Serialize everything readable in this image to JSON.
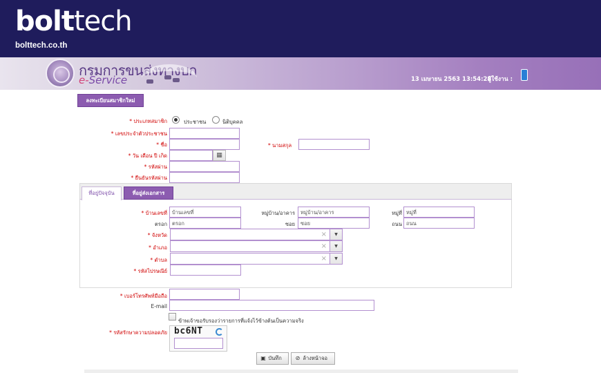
{
  "brand": {
    "logo_bold": "bolt",
    "logo_light": "tech",
    "url": "bolttech.co.th"
  },
  "banner": {
    "agency_title": "กรมการขนส่งทางบก",
    "eservice_e": "e-",
    "eservice_rest": "Service",
    "datetime": "13 เมษายน 2563 13:54:28",
    "user_label": "ผู้ใช้งาน :"
  },
  "form": {
    "register_button": "ลงทะเบียนสมาชิกใหม่",
    "member_type_label": "ประเภทสมาชิก",
    "member_type_options": [
      "ประชาชน",
      "นิติบุคคล"
    ],
    "national_id_label": "เลขประจำตัวประชาชน",
    "first_name_label": "ชื่อ",
    "last_name_label": "นามสกุล",
    "birth_date_label": "วัน เดือน ปี เกิด",
    "password_label": "รหัสผ่าน",
    "confirm_password_label": "ยืนยันรหัสผ่าน",
    "phone_label": "เบอร์โทรศัพท์มือถือ",
    "email_label": "E-mail",
    "consent_text": "ข้าพเจ้าขอรับรองว่ารายการที่แจ้งไว้ข้างต้นเป็นความจริง",
    "captcha_label": "รหัสรักษาความปลอดภัย",
    "captcha_code": "bc6NT",
    "save_button": "บันทึก",
    "clear_button": "ล้างหน้าจอ"
  },
  "address": {
    "tabs": [
      "ที่อยู่ปัจจุบัน",
      "ที่อยู่ส่งเอกสาร"
    ],
    "house_no_label": "บ้านเลขที่",
    "house_no_placeholder": "บ้านเลขที่",
    "village_label": "หมู่บ้าน/อาคาร",
    "village_placeholder": "หมู่บ้าน/อาคาร",
    "moo_label": "หมู่ที่",
    "moo_placeholder": "หมู่ที่",
    "trok_label": "ตรอก",
    "trok_placeholder": "ตรอก",
    "soi_label": "ซอย",
    "soi_placeholder": "ซอย",
    "road_label": "ถนน",
    "road_placeholder": "ถนน",
    "province_label": "จังหวัด",
    "district_label": "อำเภอ",
    "subdistrict_label": "ตำบล",
    "postcode_label": "รหัสไปรษณีย์",
    "clear_mark": "×",
    "dropdown_mark": "▼"
  },
  "icons": {
    "required_mark": "*",
    "calendar_glyph": "▦",
    "save_glyph": "▣",
    "clear_glyph": "⊘"
  }
}
